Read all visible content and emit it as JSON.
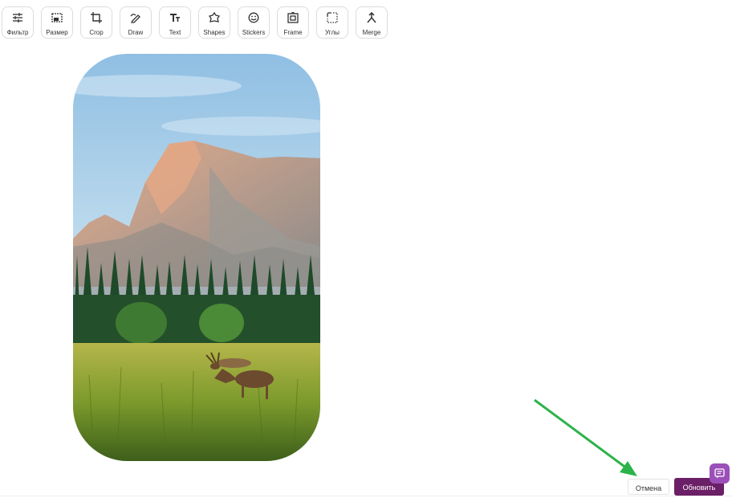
{
  "toolbar": {
    "tools": [
      {
        "label": "Фильтр",
        "icon": "sliders-icon"
      },
      {
        "label": "Размер",
        "icon": "resize-icon"
      },
      {
        "label": "Crop",
        "icon": "crop-icon"
      },
      {
        "label": "Draw",
        "icon": "draw-icon"
      },
      {
        "label": "Text",
        "icon": "text-icon"
      },
      {
        "label": "Shapes",
        "icon": "shapes-icon"
      },
      {
        "label": "Stickers",
        "icon": "sticker-icon"
      },
      {
        "label": "Frame",
        "icon": "frame-icon"
      },
      {
        "label": "Углы",
        "icon": "corners-icon"
      },
      {
        "label": "Merge",
        "icon": "merge-icon"
      }
    ]
  },
  "canvas": {
    "image_subject": "mountain-meadow-deer-photo"
  },
  "actions": {
    "cancel_label": "Отмена",
    "update_label": "Обновить"
  },
  "colors": {
    "primary": "#6b1f66",
    "chat": "#9b4fb8",
    "arrow": "#2db34a"
  }
}
